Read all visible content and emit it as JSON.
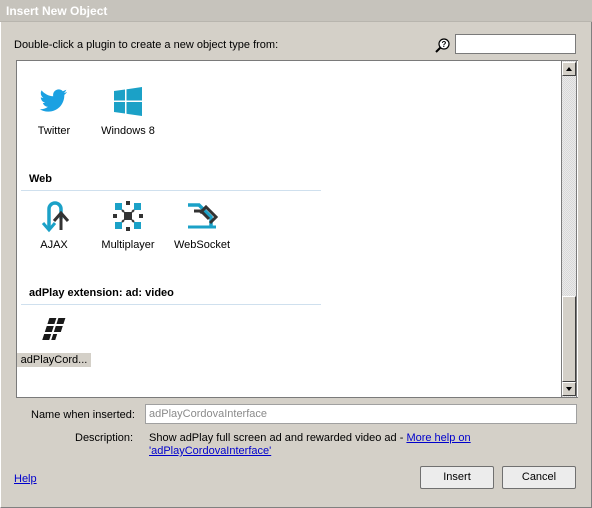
{
  "window": {
    "title": "Insert New Object"
  },
  "instruction": "Double-click a plugin to create a new object type from:",
  "search": {
    "value": "",
    "placeholder": "",
    "icon": "magnifier-help-icon"
  },
  "plugins_top": [
    {
      "label": "Twitter",
      "icon": "twitter-icon",
      "color": "#1ba1e2"
    },
    {
      "label": "Windows 8",
      "icon": "windows-icon",
      "color": "#1ba1c7"
    }
  ],
  "categories": [
    {
      "title": "Web",
      "items": [
        {
          "label": "AJAX",
          "icon": "ajax-icon"
        },
        {
          "label": "Multiplayer",
          "icon": "multiplayer-icon"
        },
        {
          "label": "WebSocket",
          "icon": "websocket-icon"
        }
      ]
    },
    {
      "title": "adPlay extension: ad: video",
      "items": [
        {
          "label": "adPlayCord...",
          "icon": "adplay-icon",
          "selected": true
        }
      ]
    }
  ],
  "name_field": {
    "label": "Name when inserted:",
    "value": "adPlayCordovaInterface"
  },
  "description": {
    "label": "Description:",
    "text": "Show adPlay full screen ad and rewarded video ad - ",
    "link": "More help on 'adPlayCordovaInterface'"
  },
  "help_link": "Help",
  "buttons": {
    "insert": "Insert",
    "cancel": "Cancel"
  },
  "colors": {
    "accent": "#1ba1c7",
    "link": "#0000cc",
    "selection": "#d4d0c8"
  }
}
